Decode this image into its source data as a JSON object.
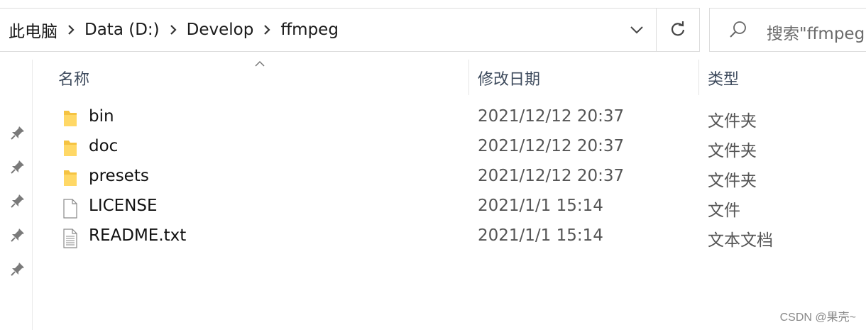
{
  "breadcrumb": {
    "items": [
      "此电脑",
      "Data (D:)",
      "Develop",
      "ffmpeg"
    ]
  },
  "search": {
    "placeholder": "搜索\"ffmpeg"
  },
  "columns": {
    "name": "名称",
    "modified": "修改日期",
    "type": "类型",
    "sort_indicator": "ascending"
  },
  "files": [
    {
      "name": "bin",
      "modified": "2021/12/12 20:37",
      "type": "文件夹",
      "icon": "folder-icon"
    },
    {
      "name": "doc",
      "modified": "2021/12/12 20:37",
      "type": "文件夹",
      "icon": "folder-icon"
    },
    {
      "name": "presets",
      "modified": "2021/12/12 20:37",
      "type": "文件夹",
      "icon": "folder-icon"
    },
    {
      "name": "LICENSE",
      "modified": "2021/1/1 15:14",
      "type": "文件",
      "icon": "file-icon"
    },
    {
      "name": "README.txt",
      "modified": "2021/1/1 15:14",
      "type": "文本文档",
      "icon": "text-file-icon"
    }
  ],
  "quick_access_pins": 5,
  "watermark": "CSDN @果壳~",
  "colors": {
    "folder": "#f5c342",
    "header_text": "#3d4a5c",
    "border": "#dcdcdc"
  }
}
